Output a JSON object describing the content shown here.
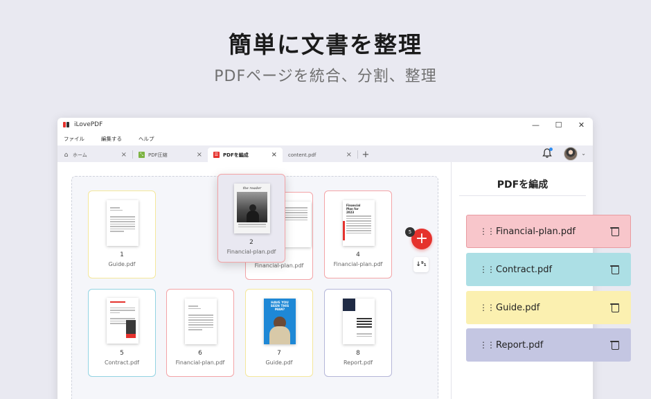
{
  "hero": {
    "title": "簡単に文書を整理",
    "subtitle": "PDFページを統合、分割、整理"
  },
  "window": {
    "app_name": "iLovePDF",
    "controls": {
      "minimize": "—",
      "maximize": "☐",
      "close": "✕"
    }
  },
  "menu": {
    "items": [
      "ファイル",
      "編集する",
      "ヘルプ"
    ]
  },
  "tabs": [
    {
      "label": "ホーム",
      "icon": "home-icon",
      "active": false
    },
    {
      "label": "PDF圧縮",
      "icon": "compress-icon",
      "active": false
    },
    {
      "label": "PDFを編成",
      "icon": "organize-icon",
      "active": true
    },
    {
      "label": "content.pdf",
      "icon": "",
      "active": false
    }
  ],
  "tab_close": "×",
  "tab_add": "+",
  "pages": [
    {
      "num": "1",
      "file": "Guide.pdf",
      "border": "#f4e79a"
    },
    {
      "num": "2",
      "file": "Financial-plan.pdf",
      "border": "#f3a3a6",
      "dragging": true
    },
    {
      "num": "3",
      "file": "Financial-plan.pdf",
      "border": "#f3a3a6"
    },
    {
      "num": "4",
      "file": "Financial-plan.pdf",
      "border": "#f3a3a6"
    },
    {
      "num": "5",
      "file": "Contract.pdf",
      "border": "#92d3e2"
    },
    {
      "num": "6",
      "file": "Financial-plan.pdf",
      "border": "#f3a3a6"
    },
    {
      "num": "7",
      "file": "Guide.pdf",
      "border": "#f4e79a"
    },
    {
      "num": "8",
      "file": "Report.pdf",
      "border": "#b4b6d8"
    }
  ],
  "thumb_texts": {
    "reader": "the reader",
    "financial": "Financial Plan for 2023",
    "have_you": "HAVE YOU SEEN THIS MAN?"
  },
  "fab": {
    "label": "+",
    "badge": "5"
  },
  "sort": {
    "label": "↓⁹₁"
  },
  "panel": {
    "title": "PDFを編成",
    "files": [
      {
        "name": "Financial-plan.pdf",
        "bg": "#f8c6cb",
        "border": "#e89aa0"
      },
      {
        "name": "Contract.pdf",
        "bg": "#acdfe5",
        "border": "#acdfe5"
      },
      {
        "name": "Guide.pdf",
        "bg": "#fbf0b0",
        "border": "#fbf0b0"
      },
      {
        "name": "Report.pdf",
        "bg": "#c4c6e2",
        "border": "#c4c6e2"
      }
    ]
  },
  "colors": {
    "accent": "#e5322d"
  }
}
